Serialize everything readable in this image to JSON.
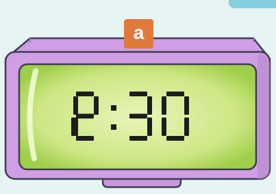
{
  "tag_label": "a",
  "clock": {
    "time": "12:30",
    "hours": "12",
    "minutes": "30"
  },
  "colors": {
    "body": "#cf9ee4",
    "body_dark": "#a97ac0",
    "outline": "#3d3d52",
    "screen": "#cde784",
    "screen_edge": "#9fcf4a",
    "digits": "#1d1d1d",
    "tag": "#e07a3c",
    "background": "#e6f4f3"
  }
}
